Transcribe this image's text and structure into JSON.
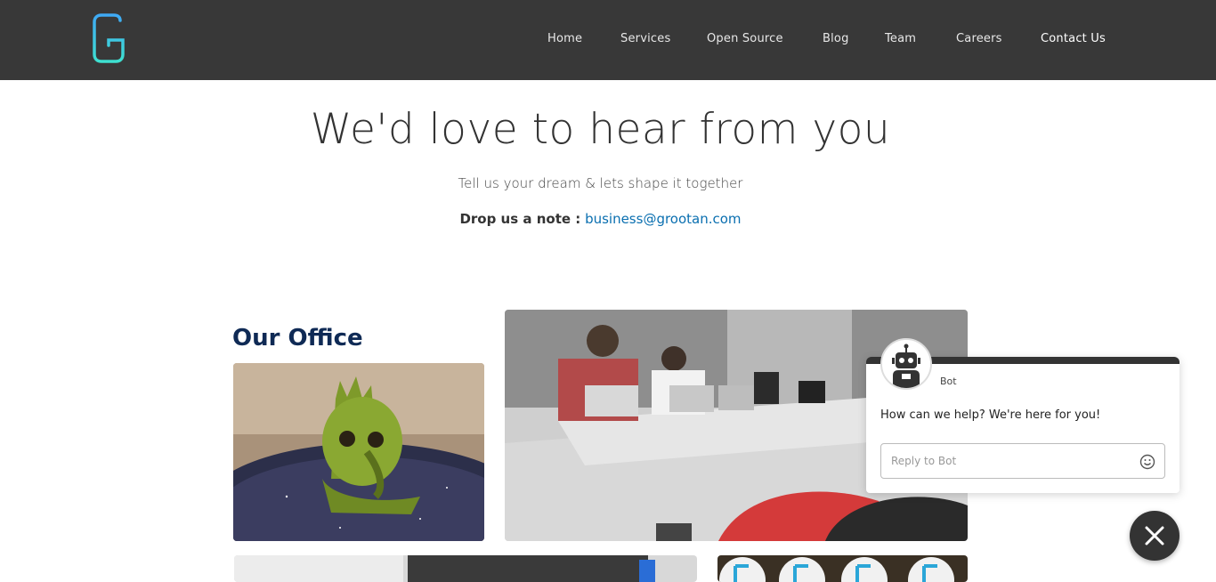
{
  "nav": {
    "items": [
      {
        "label": "Home"
      },
      {
        "label": "Services"
      },
      {
        "label": "Open Source"
      },
      {
        "label": "Blog"
      },
      {
        "label": "Team"
      },
      {
        "label": "Careers"
      },
      {
        "label": "Contact Us",
        "active": true
      }
    ]
  },
  "hero": {
    "title": "We'd love to hear from you",
    "subtitle": "Tell us your dream & lets shape it together",
    "note_label": "Drop us a note :",
    "email": "business@grootan.com"
  },
  "office": {
    "title": "Our Office"
  },
  "chat": {
    "bot_name": "Bot",
    "message": "How can we help? We're here for you!",
    "reply_placeholder": "Reply to Bot"
  },
  "colors": {
    "navbar": "#383838",
    "accent_link": "#0a6fb0",
    "logo_gradient_start": "#3fa9f5",
    "logo_gradient_end": "#3ee0d0",
    "office_title": "#0f2a55"
  }
}
